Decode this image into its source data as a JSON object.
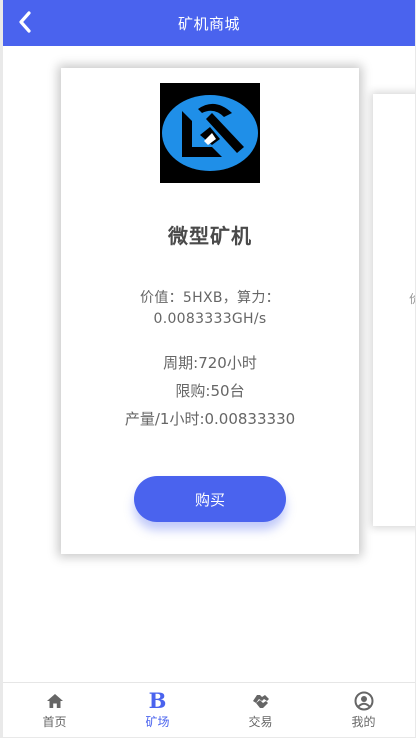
{
  "header": {
    "title": "矿机商城"
  },
  "product": {
    "name": "微型矿机",
    "value_line1": "价值：5HXB，算力：",
    "value_line2": "0.0083333GH/s",
    "period": "周期:720小时",
    "limit": "限购:50台",
    "output": "产量/1小时:0.00833330",
    "buy_label": "购买",
    "logo_icon": "pickaxe-hammer-logo-icon"
  },
  "next_card": {
    "peek_text": "价值"
  },
  "tabbar": {
    "items": [
      {
        "label": "首页",
        "icon": "home-icon"
      },
      {
        "label": "矿场",
        "icon": "b-icon",
        "active": true
      },
      {
        "label": "交易",
        "icon": "handshake-icon"
      },
      {
        "label": "我的",
        "icon": "user-icon"
      }
    ]
  },
  "colors": {
    "accent": "#4a63ee",
    "logo_blue": "#1f8fe8"
  }
}
